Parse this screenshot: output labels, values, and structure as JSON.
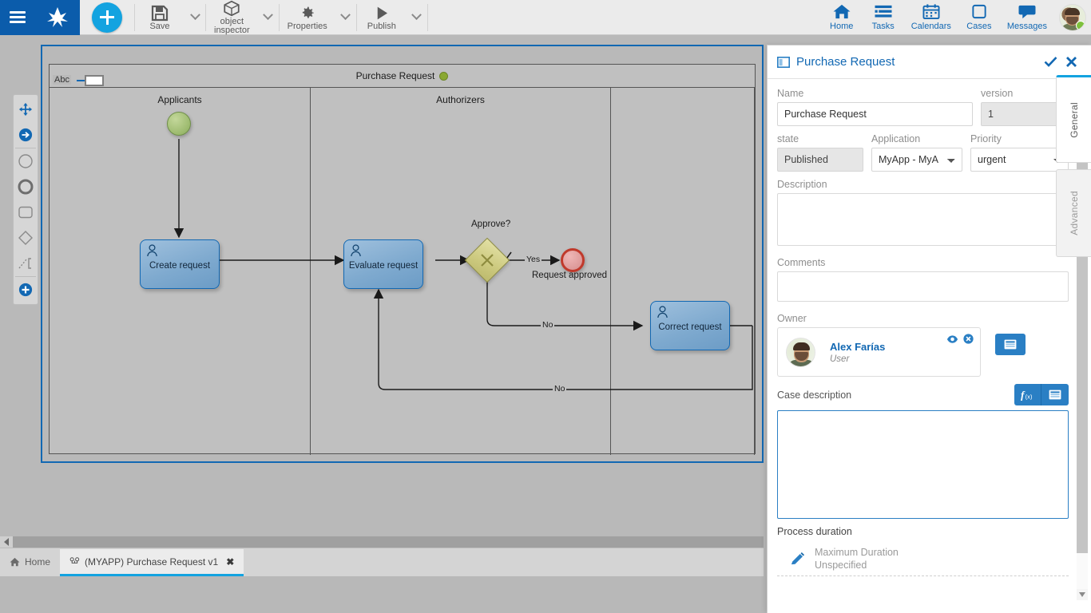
{
  "topbar": {
    "menu_icon": "hamburger-icon",
    "brand_icon": "bizagi-brand-icon",
    "add_button_icon": "plus-icon",
    "tools": [
      {
        "label": "Save",
        "icon": "save-icon",
        "has_caret": true
      },
      {
        "label": "object\ninspector",
        "label_line1": "object",
        "label_line2": "inspector",
        "icon": "cube-icon",
        "has_caret": true
      },
      {
        "label": "Properties",
        "icon": "gear-icon",
        "has_caret": true
      },
      {
        "label": "Publish",
        "icon": "play-icon",
        "has_caret": true
      }
    ],
    "right_items": [
      {
        "label": "Home",
        "icon": "home-icon"
      },
      {
        "label": "Tasks",
        "icon": "tasks-icon"
      },
      {
        "label": "Calendars",
        "icon": "calendar-icon"
      },
      {
        "label": "Cases",
        "icon": "case-square-icon"
      },
      {
        "label": "Messages",
        "icon": "message-bubble-icon"
      }
    ],
    "avatar": {
      "name": "avatar",
      "status": "online"
    }
  },
  "palette": {
    "items": [
      {
        "icon": "move-tool-icon"
      },
      {
        "icon": "sequence-flow-icon"
      },
      {
        "icon": "start-event-icon"
      },
      {
        "icon": "end-event-icon"
      },
      {
        "icon": "task-icon"
      },
      {
        "icon": "gateway-icon"
      },
      {
        "icon": "association-icon"
      },
      {
        "icon": "add-element-icon"
      }
    ]
  },
  "diagram": {
    "frame_tag": "Abc",
    "pool_title": "Purchase Request",
    "pool_status_color": "#8aa832",
    "lanes": [
      {
        "title": "Applicants"
      },
      {
        "title": "Authorizers"
      },
      {
        "title": ""
      }
    ],
    "nodes": [
      {
        "id": "start",
        "type": "start-event",
        "label": ""
      },
      {
        "id": "create",
        "type": "user-task",
        "label": "Create request"
      },
      {
        "id": "evaluate",
        "type": "user-task",
        "label": "Evaluate request"
      },
      {
        "id": "approve",
        "type": "exclusive-gateway",
        "label": "Approve?"
      },
      {
        "id": "approved",
        "type": "end-event",
        "label": "Request approved"
      },
      {
        "id": "correct",
        "type": "user-task",
        "label": "Correct request"
      }
    ],
    "flow_labels": [
      {
        "id": "yes",
        "text": "Yes"
      },
      {
        "id": "no1",
        "text": "No"
      },
      {
        "id": "no2",
        "text": "No"
      }
    ]
  },
  "side_tabs": [
    {
      "label": "General",
      "active": true
    },
    {
      "label": "Advanced",
      "active": false
    }
  ],
  "panel": {
    "title": "Purchase Request",
    "title_icon": "window-icon",
    "confirm_icon": "check-icon",
    "close_icon": "close-icon",
    "fields": {
      "name_label": "Name",
      "name_value": "Purchase Request",
      "version_label": "version",
      "version_value": "1",
      "state_label": "state",
      "state_value": "Published",
      "application_label": "Application",
      "application_value": "MyApp - MyA",
      "priority_label": "Priority",
      "priority_value": "urgent",
      "description_label": "Description",
      "description_value": "",
      "comments_label": "Comments",
      "comments_value": "",
      "owner_label": "Owner",
      "owner_name": "Alex Farías",
      "owner_role": "User",
      "owner_view_icon": "eye-icon",
      "owner_remove_icon": "remove-circle-icon",
      "owner_picker_icon": "list-picker-icon",
      "case_description_label": "Case description",
      "case_description_value": "",
      "case_fx_icon": "function-fx-icon",
      "case_picker_icon": "list-picker-icon",
      "process_duration_label": "Process duration",
      "duration_edit_icon": "pencil-icon",
      "duration_title": "Maximum Duration",
      "duration_value": "Unspecified"
    }
  },
  "taskbar": {
    "home_label": "Home",
    "home_icon": "home-small-icon",
    "doc_label": "(MYAPP) Purchase Request v1",
    "doc_icon": "process-icon",
    "doc_close_icon": "close-x-icon",
    "scroll_left_icon": "scroll-left-arrow"
  },
  "colors": {
    "brand_blue": "#0b5cab",
    "accent_cyan": "#13a3e0",
    "link_blue": "#1268b3",
    "canvas_gray": "#b9b9b9",
    "pool_gray": "#c0c0c0"
  }
}
